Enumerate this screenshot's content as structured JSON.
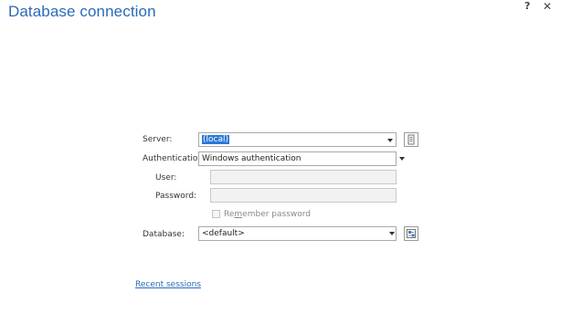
{
  "window": {
    "title": "Database connection",
    "help_label": "?",
    "close_label": "✕"
  },
  "form": {
    "server": {
      "label": "Server:",
      "value": "(local)"
    },
    "authentication": {
      "label": "Authentication:",
      "value": "Windows authentication"
    },
    "user": {
      "label": "User:",
      "value": ""
    },
    "password": {
      "label": "Password:",
      "value": ""
    },
    "remember": {
      "label_pre": "Re",
      "label_accel": "m",
      "label_post": "ember password",
      "checked": false
    },
    "database": {
      "label": "Database:",
      "value": "<default>"
    }
  },
  "footer": {
    "recent_sessions_label": "Recent sessions"
  },
  "icons": {
    "server_browse": "server-list-icon",
    "database_browse": "database-browse-icon",
    "dropdown": "chevron-down-icon"
  }
}
